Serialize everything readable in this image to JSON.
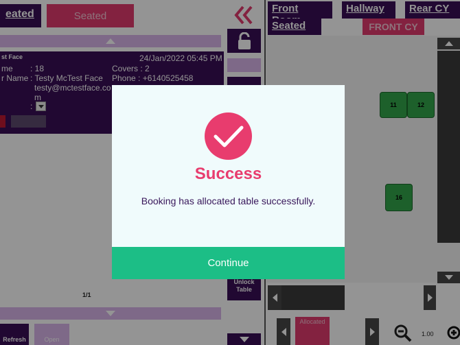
{
  "top_tabs": {
    "seated_partial": "eated",
    "seated_button": "Seated"
  },
  "rooms": {
    "front_room": "Front Room",
    "hallway": "Hallway",
    "rear_cy": "Rear CY",
    "seated": "Seated",
    "front_cy": "FRONT CY"
  },
  "booking": {
    "title_partial": "st Face",
    "datetime": "24/Jan/2022 05:45 PM",
    "name_label": "me",
    "name_value": ": 18",
    "customer_label": "r Name",
    "customer_value": ": Testy McTest Face",
    "email_value": "testy@mctestface.co",
    "email_wrap": "m",
    "covers": "Covers : 2",
    "phone": "Phone : +6140525458",
    "dropdown_prefix": ":"
  },
  "pagination": "1/1",
  "bottom_buttons": {
    "refresh": "Refresh",
    "open": "Open",
    "unlock_table_line1": "Unlock",
    "unlock_table_line2": "Table"
  },
  "tables": [
    {
      "label": "11"
    },
    {
      "label": "12"
    },
    {
      "label": "16"
    }
  ],
  "floor_bottom": {
    "allocated": "Allocated",
    "zoom_level": "1.00"
  },
  "modal": {
    "title": "Success",
    "message": "Booking has allocated table successfully.",
    "continue_label": "Continue"
  },
  "colors": {
    "purple": "#3a0f57",
    "pink": "#e83c6e",
    "green": "#1cbe86",
    "lavender": "#d9b6ea",
    "table_green": "#33a64a"
  },
  "icons": [
    "double-chevron-left-icon",
    "unlock-icon",
    "chevron-up-icon",
    "chevron-down-icon",
    "chevron-left-icon",
    "chevron-right-icon",
    "zoom-out-icon",
    "zoom-in-icon",
    "checkmark-icon"
  ]
}
